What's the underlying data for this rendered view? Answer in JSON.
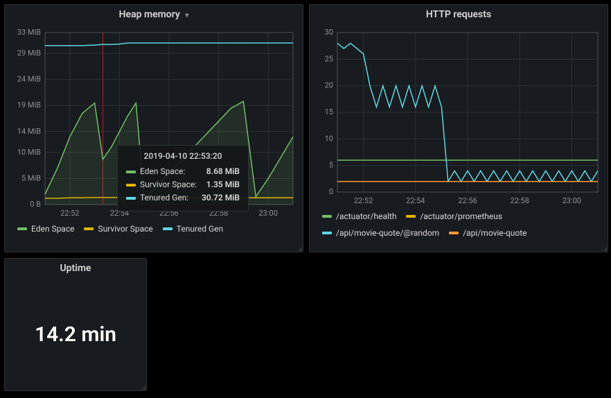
{
  "colors": {
    "eden": "#73bf69",
    "survivor": "#e0b400",
    "tenured": "#5dd8e5",
    "health": "#73bf69",
    "prometheus": "#e0b400",
    "random": "#5dd8e5",
    "movie": "#ff9830",
    "cursor": "#c4162a"
  },
  "heap": {
    "title": "Heap memory",
    "legend": [
      "Eden Space",
      "Survivor Space",
      "Tenured Gen"
    ],
    "tooltip": {
      "time": "2019-04-10 22:53:20",
      "rows": [
        {
          "label": "Eden Space:",
          "value": "8.68 MiB",
          "colorKey": "eden"
        },
        {
          "label": "Survivor Space:",
          "value": "1.35 MiB",
          "colorKey": "survivor"
        },
        {
          "label": "Tenured Gen:",
          "value": "30.72 MiB",
          "colorKey": "tenured"
        }
      ]
    }
  },
  "http": {
    "title": "HTTP requests",
    "legend": [
      "/actuator/health",
      "/actuator/prometheus",
      "/api/movie-quote/@random",
      "/api/movie-quote"
    ]
  },
  "uptime": {
    "title": "Uptime",
    "value": "14.2 min"
  },
  "chart_data": [
    {
      "type": "line",
      "title": "Heap memory",
      "xlabel": "",
      "ylabel": "MiB",
      "ylim": [
        0,
        33
      ],
      "x": [
        "22:51:00",
        "22:51:30",
        "22:52:00",
        "22:52:30",
        "22:53:00",
        "22:53:20",
        "22:53:40",
        "22:54:00",
        "22:54:20",
        "22:54:40",
        "22:55:00",
        "22:55:30",
        "22:56:00",
        "22:56:30",
        "22:57:00",
        "22:57:30",
        "22:58:00",
        "22:58:30",
        "22:59:00",
        "22:59:30",
        "23:00:00",
        "23:00:30",
        "23:01:00"
      ],
      "x_ticks": [
        "22:52",
        "22:54",
        "22:56",
        "22:58",
        "23:00"
      ],
      "y_ticks": [
        "0 B",
        "5 MiB",
        "10 MiB",
        "14 MiB",
        "19 MiB",
        "24 MiB",
        "29 MiB",
        "33 MiB"
      ],
      "series": [
        {
          "name": "Eden Space",
          "values": [
            2.0,
            7.0,
            13.0,
            17.5,
            19.5,
            8.68,
            11.0,
            14.0,
            17.0,
            19.5,
            1.0,
            3.5,
            6.0,
            8.5,
            11.0,
            13.5,
            16.0,
            18.5,
            19.8,
            1.5,
            5.0,
            9.0,
            13.0
          ]
        },
        {
          "name": "Survivor Space",
          "values": [
            1.2,
            1.2,
            1.3,
            1.3,
            1.35,
            1.35,
            1.35,
            1.35,
            1.35,
            1.35,
            1.3,
            1.3,
            1.3,
            1.3,
            1.3,
            1.3,
            1.3,
            1.3,
            1.3,
            1.3,
            1.3,
            1.3,
            1.3
          ]
        },
        {
          "name": "Tenured Gen",
          "values": [
            30.5,
            30.5,
            30.5,
            30.5,
            30.6,
            30.72,
            30.72,
            30.8,
            31.0,
            31.0,
            31.0,
            31.0,
            31.0,
            31.0,
            31.0,
            31.0,
            31.0,
            31.0,
            31.0,
            31.0,
            31.0,
            31.0,
            31.0
          ]
        }
      ],
      "cursor_x": "22:53:20"
    },
    {
      "type": "line",
      "title": "HTTP requests",
      "xlabel": "",
      "ylabel": "",
      "ylim": [
        0,
        30
      ],
      "x": [
        "22:51:00",
        "22:51:15",
        "22:51:30",
        "22:51:45",
        "22:52:00",
        "22:52:15",
        "22:52:30",
        "22:52:45",
        "22:53:00",
        "22:53:15",
        "22:53:30",
        "22:53:45",
        "22:54:00",
        "22:54:15",
        "22:54:30",
        "22:54:45",
        "22:55:00",
        "22:55:15",
        "22:55:30",
        "22:55:45",
        "22:56:00",
        "22:56:15",
        "22:56:30",
        "22:56:45",
        "22:57:00",
        "22:57:15",
        "22:57:30",
        "22:57:45",
        "22:58:00",
        "22:58:15",
        "22:58:30",
        "22:58:45",
        "22:59:00",
        "22:59:15",
        "22:59:30",
        "22:59:45",
        "23:00:00",
        "23:00:15",
        "23:00:30",
        "23:00:45",
        "23:01:00"
      ],
      "x_ticks": [
        "22:52",
        "22:54",
        "22:56",
        "22:58",
        "23:00"
      ],
      "y_ticks": [
        0,
        5,
        10,
        15,
        20,
        25,
        30
      ],
      "series": [
        {
          "name": "/actuator/health",
          "values": [
            6,
            6,
            6,
            6,
            6,
            6,
            6,
            6,
            6,
            6,
            6,
            6,
            6,
            6,
            6,
            6,
            6,
            6,
            6,
            6,
            6,
            6,
            6,
            6,
            6,
            6,
            6,
            6,
            6,
            6,
            6,
            6,
            6,
            6,
            6,
            6,
            6,
            6,
            6,
            6,
            6
          ]
        },
        {
          "name": "/actuator/prometheus",
          "values": [
            2,
            2,
            2,
            2,
            2,
            2,
            2,
            2,
            2,
            2,
            2,
            2,
            2,
            2,
            2,
            2,
            2,
            2,
            2,
            2,
            2,
            2,
            2,
            2,
            2,
            2,
            2,
            2,
            2,
            2,
            2,
            2,
            2,
            2,
            2,
            2,
            2,
            2,
            2,
            2,
            2
          ]
        },
        {
          "name": "/api/movie-quote/@random",
          "values": [
            28,
            27,
            28,
            27,
            26,
            20,
            16,
            20,
            16,
            20,
            16,
            20,
            16,
            20,
            16,
            20,
            16,
            2,
            4,
            2,
            4,
            2,
            4,
            2,
            4,
            2,
            4,
            2,
            4,
            2,
            4,
            2,
            4,
            2,
            4,
            2,
            4,
            2,
            4,
            2,
            4
          ]
        },
        {
          "name": "/api/movie-quote",
          "values": [
            2,
            2,
            2,
            2,
            2,
            2,
            2,
            2,
            2,
            2,
            2,
            2,
            2,
            2,
            2,
            2,
            2,
            2,
            2,
            2,
            2,
            2,
            2,
            2,
            2,
            2,
            2,
            2,
            2,
            2,
            2,
            2,
            2,
            2,
            2,
            2,
            2,
            2,
            2,
            2,
            2
          ]
        }
      ]
    }
  ]
}
